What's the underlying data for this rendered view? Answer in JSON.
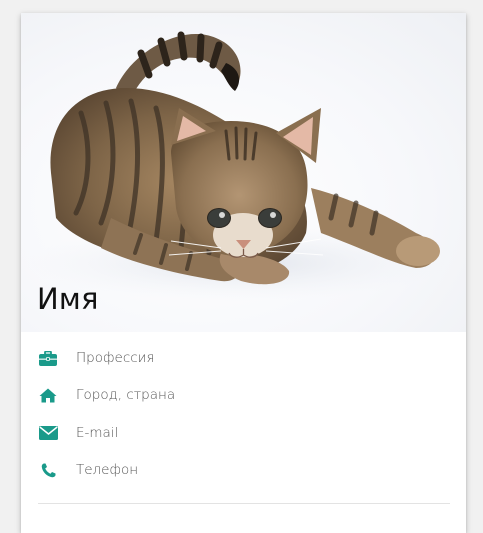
{
  "card": {
    "name": "Имя",
    "photo_subject": "cat-photo",
    "accent_color": "#1a9a8a",
    "rows": [
      {
        "icon": "briefcase-icon",
        "label": "Профессия"
      },
      {
        "icon": "home-icon",
        "label": "Город, страна"
      },
      {
        "icon": "envelope-icon",
        "label": "E-mail"
      },
      {
        "icon": "phone-icon",
        "label": "Телефон"
      }
    ]
  }
}
